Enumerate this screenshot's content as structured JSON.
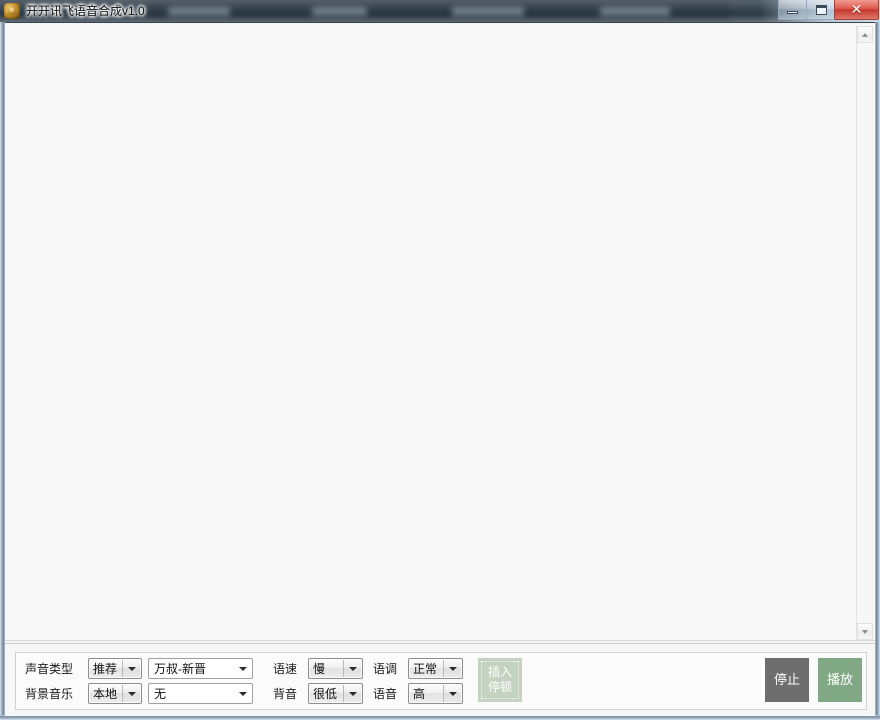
{
  "window": {
    "title": "开开讯飞语音合成v1.0",
    "app_icon": "app-logo-icon",
    "controls": {
      "minimize": "minimize-icon",
      "maximize": "maximize-icon",
      "close": "✕"
    }
  },
  "editor": {
    "value": "",
    "placeholder": ""
  },
  "scrollbar": {
    "up_arrow": "scroll-up-icon",
    "down_arrow": "scroll-down-icon"
  },
  "panel": {
    "row1": {
      "voice_type_label": "声音类型",
      "voice_category_value": "推荐",
      "voice_name_value": "万叔-新晋",
      "speed_label": "语速",
      "speed_value": "慢",
      "tone_label": "语调",
      "tone_value": "正常"
    },
    "row2": {
      "bgm_label": "背景音乐",
      "bgm_source_value": "本地",
      "bgm_track_value": "无",
      "bg_volume_label": "背音",
      "bg_volume_value": "很低",
      "voice_volume_label": "语音",
      "voice_volume_value": "高"
    },
    "buttons": {
      "insert_pause_line1": "插入",
      "insert_pause_line2": "停顿",
      "stop": "停止",
      "play": "播放"
    }
  },
  "colors": {
    "play_green": "#81a884",
    "stop_gray": "#6e6e6e",
    "pause_green": "#c3d3c0",
    "titlebar_dark": "#32404d",
    "editor_bg": "#f8f8f8"
  }
}
